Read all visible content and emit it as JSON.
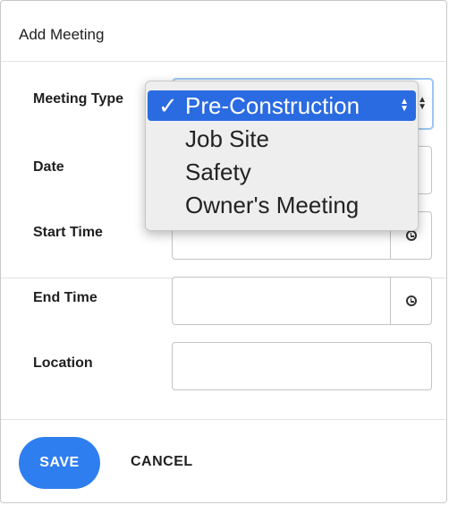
{
  "dialog": {
    "title": "Add Meeting"
  },
  "fields": {
    "meeting_type": {
      "label": "Meeting Type",
      "selected": "Pre-Construction"
    },
    "date": {
      "label": "Date",
      "value": ""
    },
    "start_time": {
      "label": "Start Time",
      "value": ""
    },
    "end_time": {
      "label": "End Time",
      "value": ""
    },
    "location": {
      "label": "Location",
      "value": ""
    }
  },
  "dropdown": {
    "check_glyph": "✓",
    "options": [
      "Pre-Construction",
      "Job Site",
      "Safety",
      "Owner's Meeting"
    ]
  },
  "actions": {
    "save_label": "SAVE",
    "cancel_label": "CANCEL"
  },
  "colors": {
    "accent": "#2f7ef0",
    "selected_option": "#2a6be2",
    "focus_ring": "#9cc7f2"
  },
  "icons": {
    "time_picker": "clock-icon",
    "select": "select-arrows-icon",
    "selected": "checkmark-icon"
  }
}
